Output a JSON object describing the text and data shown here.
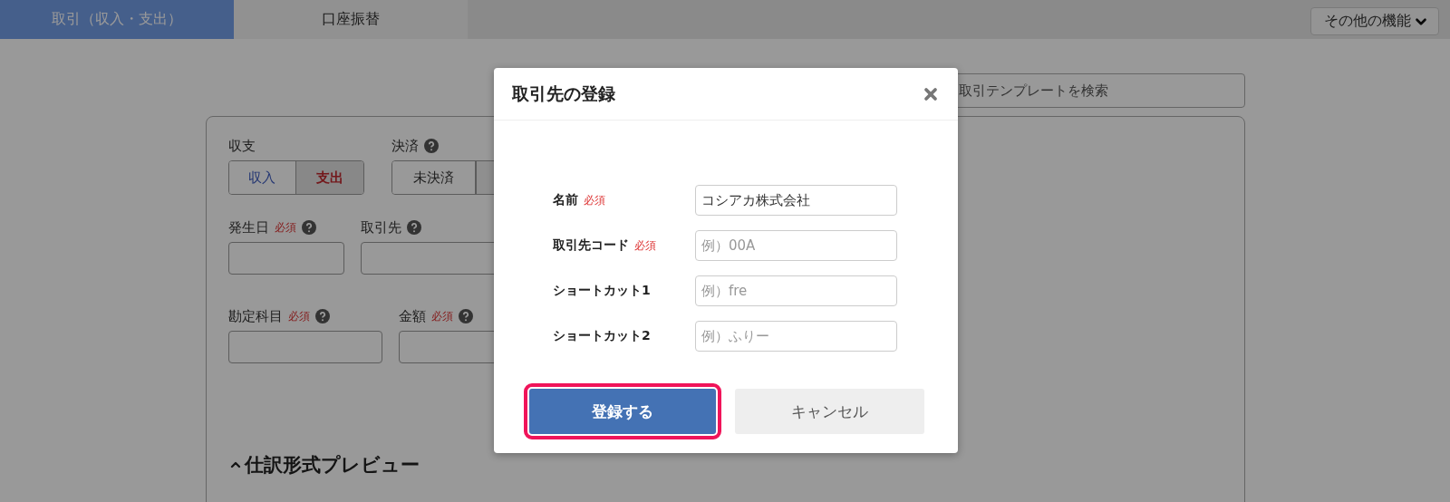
{
  "tabs": [
    {
      "label": "取引（収入・支出）",
      "selected": true
    },
    {
      "label": "口座振替",
      "selected": false
    }
  ],
  "menu_button": {
    "label": "その他の機能"
  },
  "template_search": {
    "placeholder": "取引テンプレートを検索"
  },
  "form": {
    "income_expense": {
      "label": "収支",
      "options": [
        {
          "label": "収入",
          "kind": "income",
          "selected": false
        },
        {
          "label": "支出",
          "kind": "expense",
          "selected": true
        }
      ]
    },
    "settlement": {
      "label": "決済",
      "options": [
        {
          "label": "未決済",
          "selected": false
        }
      ]
    },
    "rows": [
      [
        {
          "label": "発生日",
          "required_label": "必須"
        },
        {
          "label": "取引先"
        }
      ],
      [
        {
          "label": "勘定科目",
          "required_label": "必須"
        },
        {
          "label": "金額",
          "required_label": "必須"
        }
      ]
    ]
  },
  "preview": {
    "title": "仕訳形式プレビュー",
    "expanded": true
  },
  "dialog": {
    "title": "取引先の登録",
    "fields": [
      {
        "label": "名前",
        "required_label": "必須",
        "value": "コシアカ株式会社"
      },
      {
        "label": "取引先コード",
        "required_label": "必須",
        "placeholder": "例）00A"
      },
      {
        "label": "ショートカット1",
        "placeholder": "例）fre"
      },
      {
        "label": "ショートカット2",
        "placeholder": "例）ふりー"
      }
    ],
    "buttons": [
      {
        "label": "登録する",
        "kind": "primary",
        "focused": true
      },
      {
        "label": "キャンセル",
        "kind": "secondary",
        "focused": false
      }
    ]
  }
}
